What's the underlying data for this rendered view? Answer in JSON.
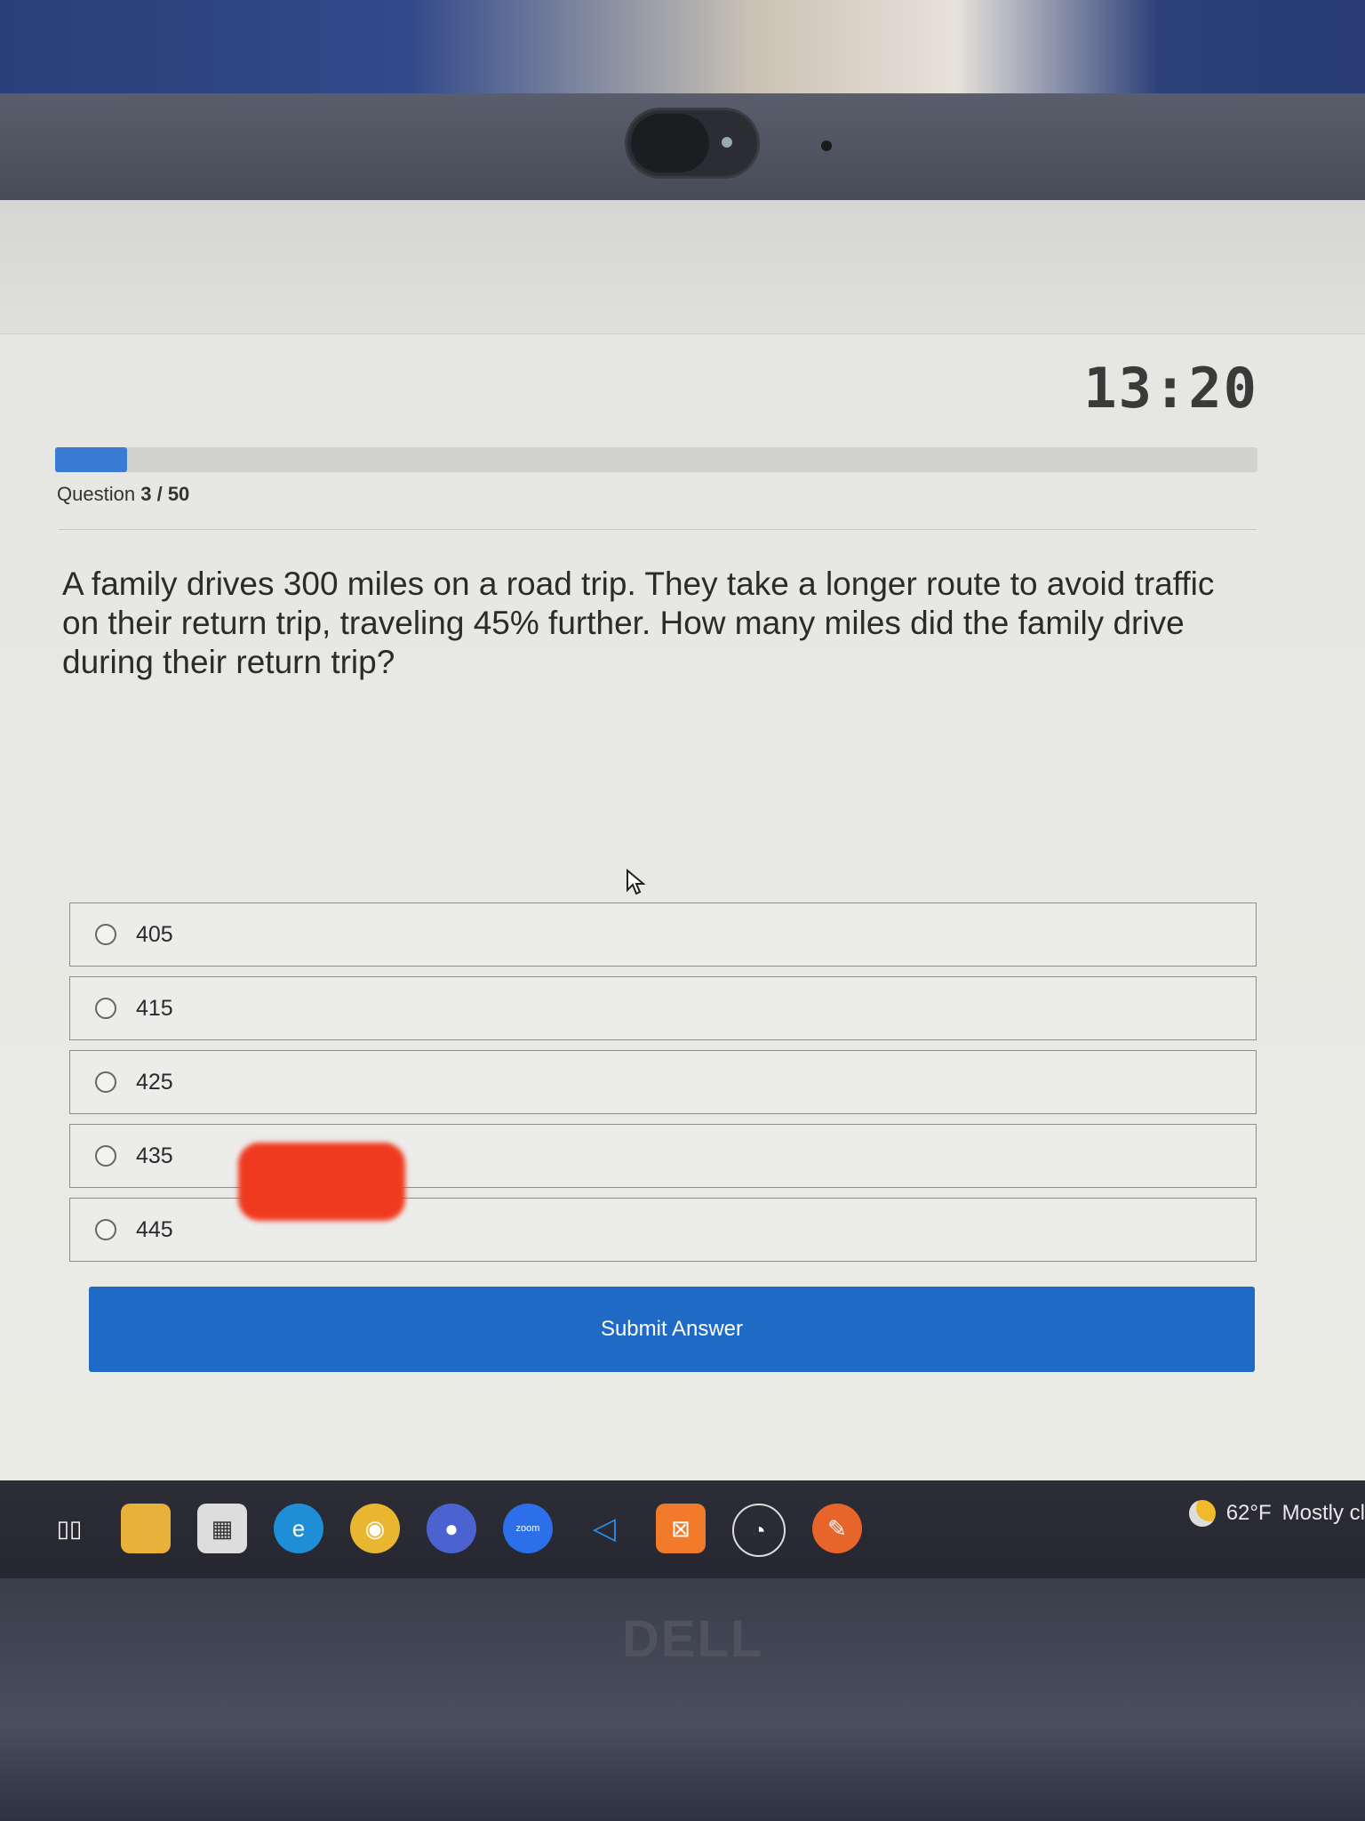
{
  "timer": {
    "value": "13:20"
  },
  "progress": {
    "fraction": 0.06,
    "color": "#3a7bd5"
  },
  "question_counter": {
    "prefix": "Question",
    "current": "3",
    "separator": "/",
    "total": "50"
  },
  "question": {
    "text": "A family drives 300 miles on a road trip. They take a longer route to avoid traffic on their return trip, traveling 45% further. How many miles did the family drive during their return trip?"
  },
  "options": [
    {
      "label": "405"
    },
    {
      "label": "415"
    },
    {
      "label": "425"
    },
    {
      "label": "435"
    },
    {
      "label": "445"
    }
  ],
  "submit": {
    "label": "Submit Answer",
    "color": "#1f6ac4"
  },
  "taskbar": {
    "icons": [
      "task-view-icon",
      "file-explorer-icon",
      "microsoft-store-icon",
      "edge-icon",
      "chrome-icon",
      "app-icon",
      "zoom-icon",
      "vscode-icon",
      "xampp-icon",
      "obs-icon",
      "app-orange-icon"
    ],
    "zoom_label": "zoom",
    "weather": {
      "temp": "62°F",
      "condition": "Mostly cl"
    }
  },
  "brand": "DELL",
  "redaction_color": "#f03a20"
}
